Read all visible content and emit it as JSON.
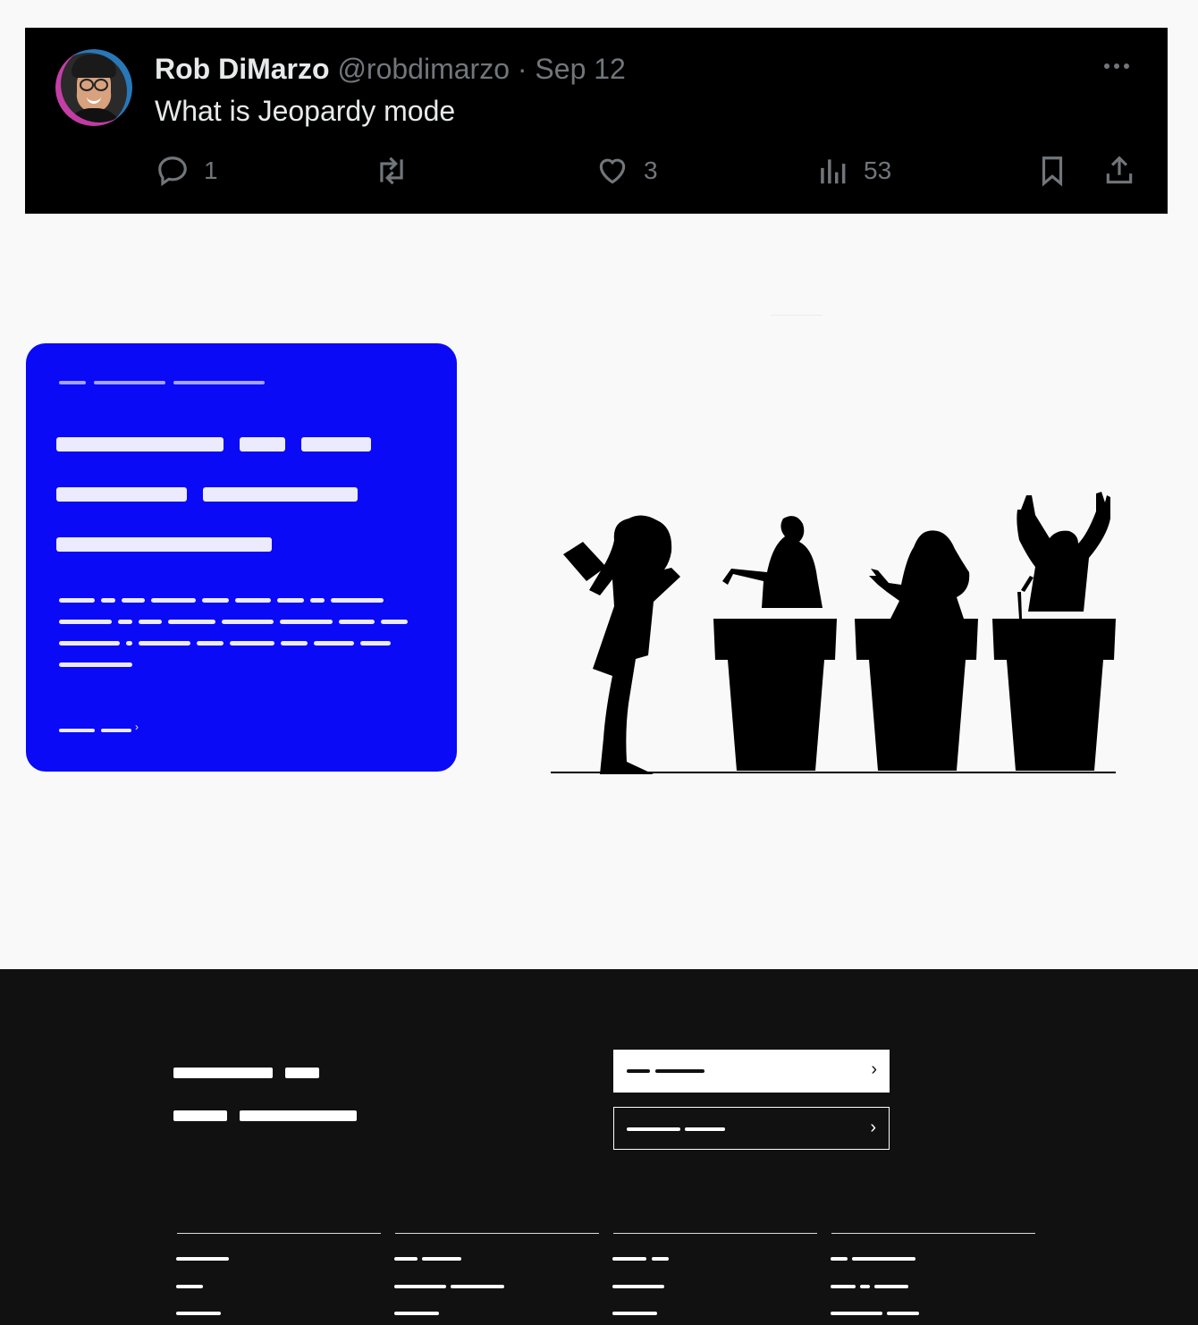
{
  "tweet": {
    "author_name": "Rob DiMarzo",
    "author_handle": "@robdimarzo",
    "separator": "·",
    "date": "Sep 12",
    "text": "What is Jeopardy mode",
    "reply_count": "1",
    "retweet_count": "",
    "like_count": "3",
    "view_count": "53"
  },
  "icons": {
    "more": "more-icon",
    "reply": "reply-icon",
    "retweet": "retweet-icon",
    "like": "heart-icon",
    "views": "views-icon",
    "bookmark": "bookmark-icon",
    "share": "share-icon"
  },
  "card": {
    "link_chevron": "›"
  },
  "footer": {
    "button_chevron": "›"
  },
  "colors": {
    "tweet_bg": "#000000",
    "card_bg": "#0a0af7",
    "footer_bg": "#111111",
    "muted_text": "#71767b"
  }
}
